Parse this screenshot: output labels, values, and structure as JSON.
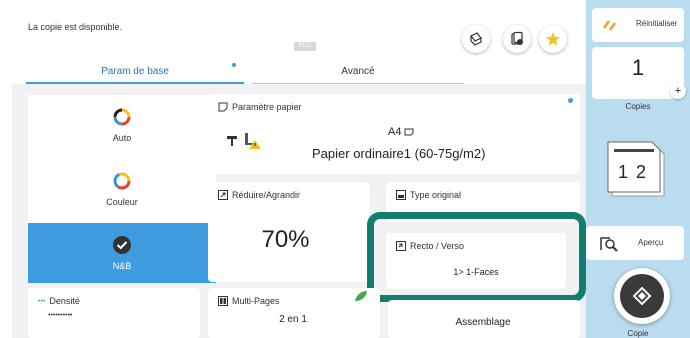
{
  "status": {
    "message": "La copie est disponible.",
    "badge": "ECO"
  },
  "tabs": [
    {
      "label": "Param de base",
      "active": true
    },
    {
      "label": "Avancé",
      "active": false
    }
  ],
  "color_mode": {
    "options": [
      {
        "label": "Auto",
        "selected": false
      },
      {
        "label": "Couleur",
        "selected": false
      },
      {
        "label": "N&B",
        "selected": true
      }
    ]
  },
  "paper": {
    "title": "Paramètre papier",
    "size": "A4",
    "type": "Papier ordinaire1 (60-75g/m2)"
  },
  "zoom": {
    "title": "Réduire/Agrandir",
    "value": "70%"
  },
  "original": {
    "title": "Type original"
  },
  "duplex": {
    "title": "Recto / Verso",
    "value": "1> 1-Faces"
  },
  "density": {
    "title": "Densité",
    "scale": "••••••••••",
    "level": 6,
    "steps": 9
  },
  "multi_pages": {
    "title": "Multi-Pages",
    "value": "2 en 1"
  },
  "assemble": {
    "label": "Assemblage"
  },
  "right": {
    "reset_label": "Réinitialiser",
    "copies_value": "1",
    "copies_label": "Copies",
    "collate_pages": [
      "1",
      "2"
    ],
    "preview_label": "Aperçu",
    "start_label": "Copie",
    "plus": "+"
  },
  "colors": {
    "accent": "#3f9ce0",
    "highlight": "#137d70",
    "panel": "#b9dcef"
  },
  "icons": [
    "document-gear-icon",
    "job-list-icon",
    "star-icon",
    "reset-icon",
    "preview-icon",
    "start-icon",
    "leaf-icon",
    "warning-icon"
  ]
}
